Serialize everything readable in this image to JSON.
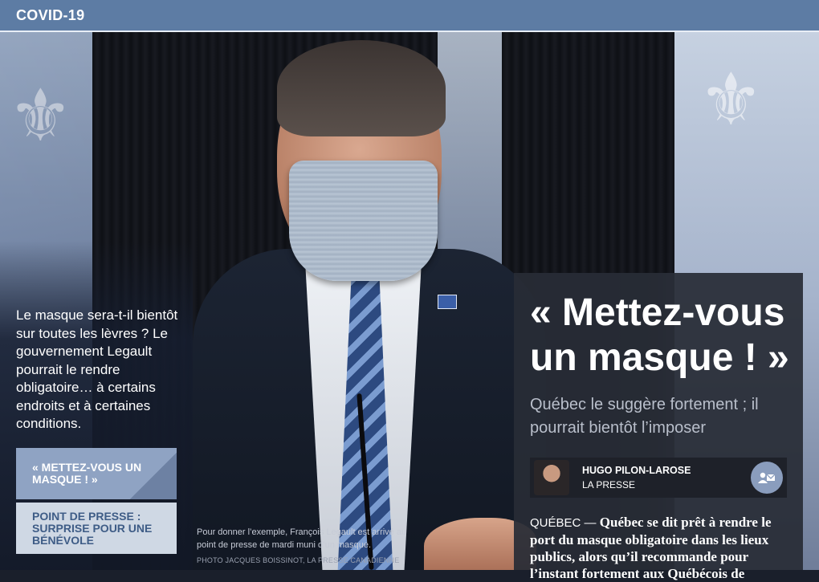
{
  "topbar": {
    "section": "COVID-19"
  },
  "intro": "Le masque sera-t-il bientôt sur toutes les lèvres ? Le gouvernement Legault pourrait le rendre obligatoire… à certains endroits et à certaines conditions.",
  "links": [
    {
      "label": "« METTEZ-VOUS UN MASQUE ! »"
    },
    {
      "label": "POINT DE PRESSE : SURPRISE POUR UNE BÉNÉVOLE"
    }
  ],
  "photo": {
    "caption": "Pour donner l’exemple, François Legault est arrivé au point de presse de mardi muni d’un masque.",
    "credit": "PHOTO JACQUES BOISSINOT, LA PRESSE CANADIENNE"
  },
  "article": {
    "headline": "« Mettez-vous un masque ! »",
    "dek": "Québec le suggère fortement ; il pourrait bientôt l’imposer",
    "author": "HUGO PILON-LAROSE",
    "outlet": "LA PRESSE",
    "contact_icon": "contact-author-icon",
    "dateline": "QUÉBEC —",
    "lead": "Québec se dit prêt à rendre le port du masque obligatoire dans les lieux publics, alors qu’il recommande pour l’instant fortement aux Québécois de"
  }
}
